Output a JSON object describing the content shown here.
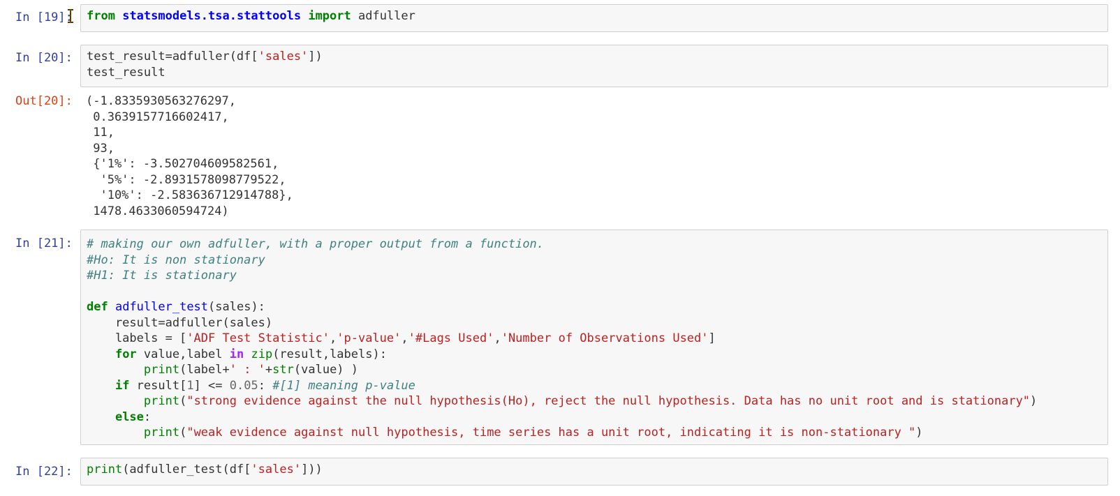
{
  "cells": [
    {
      "prompt": "In [19]:",
      "tokens": [
        {
          "t": "from",
          "c": "kw"
        },
        {
          "t": " "
        },
        {
          "t": "statsmodels.tsa.stattools",
          "c": "mod"
        },
        {
          "t": " "
        },
        {
          "t": "import",
          "c": "kw"
        },
        {
          "t": " adfuller"
        }
      ]
    },
    {
      "prompt": "In [20]:",
      "tokens": [
        {
          "t": "test_result=adfuller(df["
        },
        {
          "t": "'sales'",
          "c": "str"
        },
        {
          "t": "])\ntest_result"
        }
      ],
      "out_prompt": "Out[20]:",
      "output": "(-1.8335930563276297,\n 0.3639157716602417,\n 11,\n 93,\n {'1%': -3.502704609582561,\n  '5%': -2.8931578098779522,\n  '10%': -2.583636712914788},\n 1478.4633060594724)"
    },
    {
      "prompt": "In [21]:",
      "tokens": [
        {
          "t": "# making our own adfuller, with a proper output from a function.",
          "c": "com"
        },
        {
          "t": "\n"
        },
        {
          "t": "#Ho: It is non stationary",
          "c": "com"
        },
        {
          "t": "\n"
        },
        {
          "t": "#H1: It is stationary",
          "c": "com"
        },
        {
          "t": "\n\n"
        },
        {
          "t": "def",
          "c": "kw"
        },
        {
          "t": " "
        },
        {
          "t": "adfuller_test",
          "c": "fn"
        },
        {
          "t": "(sales):\n    result=adfuller(sales)\n    labels = ["
        },
        {
          "t": "'ADF Test Statistic'",
          "c": "str"
        },
        {
          "t": ","
        },
        {
          "t": "'p-value'",
          "c": "str"
        },
        {
          "t": ","
        },
        {
          "t": "'#Lags Used'",
          "c": "str"
        },
        {
          "t": ","
        },
        {
          "t": "'Number of Observations Used'",
          "c": "str"
        },
        {
          "t": "]\n    "
        },
        {
          "t": "for",
          "c": "kw"
        },
        {
          "t": " value,label "
        },
        {
          "t": "in",
          "c": "op"
        },
        {
          "t": " "
        },
        {
          "t": "zip",
          "c": "bi"
        },
        {
          "t": "(result,labels):\n        "
        },
        {
          "t": "print",
          "c": "bi"
        },
        {
          "t": "(label+"
        },
        {
          "t": "' : '",
          "c": "str"
        },
        {
          "t": "+"
        },
        {
          "t": "str",
          "c": "bi"
        },
        {
          "t": "(value) )\n    "
        },
        {
          "t": "if",
          "c": "kw"
        },
        {
          "t": " result["
        },
        {
          "t": "1",
          "c": "num"
        },
        {
          "t": "] <= "
        },
        {
          "t": "0.05",
          "c": "num"
        },
        {
          "t": ": "
        },
        {
          "t": "#[1] meaning p-value",
          "c": "com"
        },
        {
          "t": "\n        "
        },
        {
          "t": "print",
          "c": "bi"
        },
        {
          "t": "("
        },
        {
          "t": "\"strong evidence against the null hypothesis(Ho), reject the null hypothesis. Data has no unit root and is stationary\"",
          "c": "str"
        },
        {
          "t": ")\n    "
        },
        {
          "t": "else",
          "c": "kw"
        },
        {
          "t": ":\n        "
        },
        {
          "t": "print",
          "c": "bi"
        },
        {
          "t": "("
        },
        {
          "t": "\"weak evidence against null hypothesis, time series has a unit root, indicating it is non-stationary \"",
          "c": "str"
        },
        {
          "t": ")"
        }
      ]
    },
    {
      "prompt": "In [22]:",
      "tokens": [
        {
          "t": "print",
          "c": "bi"
        },
        {
          "t": "(adfuller_test(df["
        },
        {
          "t": "'sales'",
          "c": "str"
        },
        {
          "t": "]))"
        }
      ]
    }
  ],
  "icons": {
    "cursor": "text-cursor-icon"
  }
}
